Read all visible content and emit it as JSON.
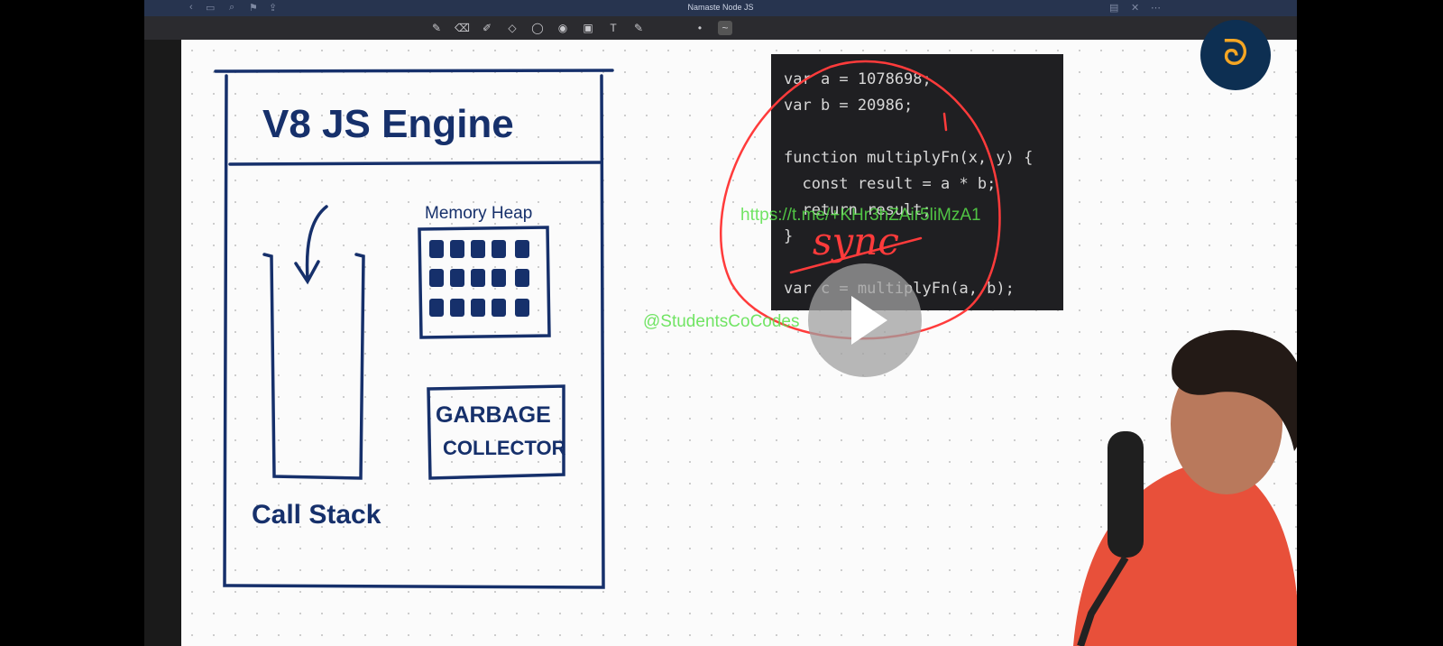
{
  "window": {
    "title": "Namaste Node JS"
  },
  "diagram": {
    "engine_title": "V8 JS Engine",
    "memory_heap_label": "Memory Heap",
    "garbage_line1": "GARBAGE",
    "garbage_line2": "COLLECTOR",
    "call_stack_label": "Call Stack",
    "annotation": "sync"
  },
  "code": {
    "lines": [
      "var a = 1078698;",
      "var b = 20986;",
      "",
      "function multiplyFn(x, y) {",
      "  const result = a * b;",
      "  return result;",
      "}",
      "",
      "var c = multiplyFn(a, b);"
    ]
  },
  "watermarks": {
    "link": "https://t.me/+KHr3hZAir5liMzA1",
    "handle": "@StudentsCoCodes"
  },
  "player": {
    "play_icon": "play-icon"
  },
  "logo": {
    "glyph": "ᘐ"
  }
}
